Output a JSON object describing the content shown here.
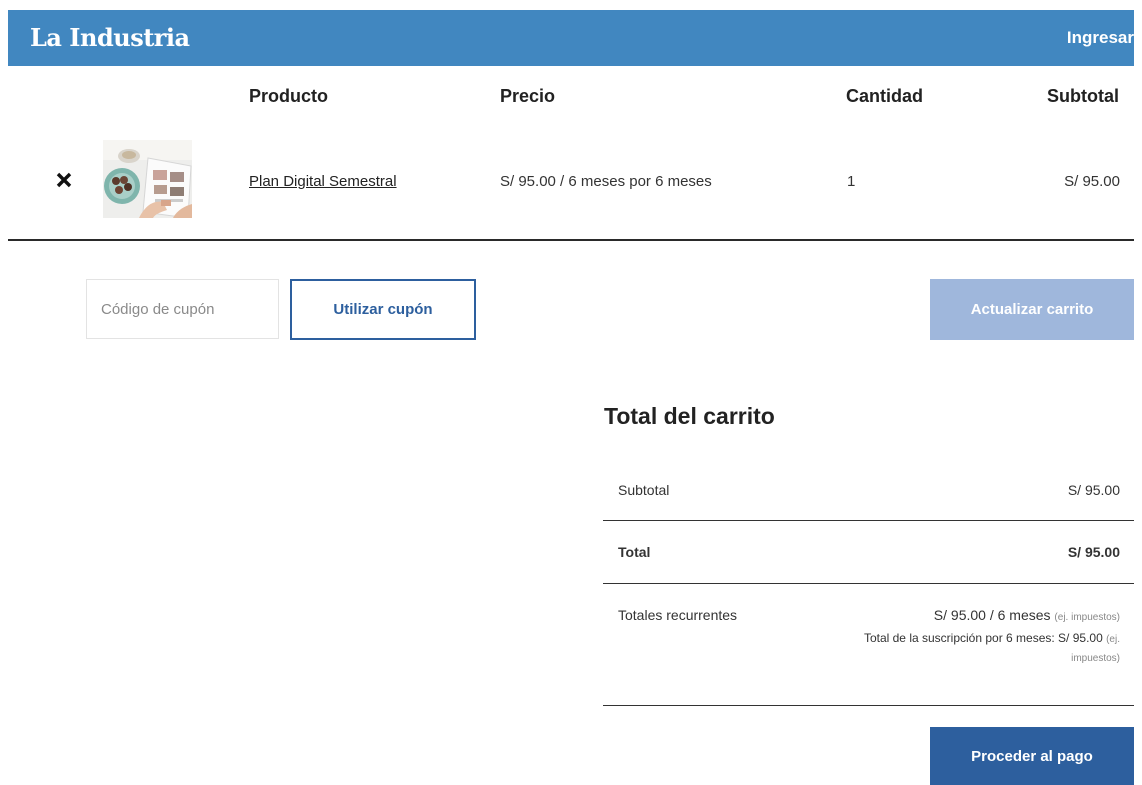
{
  "header": {
    "logo": "La Industria",
    "login_label": "Ingresar",
    "bg_color": "#4187c0"
  },
  "cart_table": {
    "columns": [
      "Producto",
      "Precio",
      "Cantidad",
      "Subtotal"
    ],
    "rows": [
      {
        "remove_icon": "close-icon",
        "product": "Plan Digital Semestral",
        "price": "S/ 95.00 / 6 meses por 6 meses",
        "quantity": "1",
        "subtotal": "S/ 95.00"
      }
    ]
  },
  "coupon": {
    "placeholder": "Código de cupón",
    "apply_label": "Utilizar cupón"
  },
  "update_cart_label": "Actualizar carrito",
  "totals": {
    "title": "Total del carrito",
    "subtotal_label": "Subtotal",
    "subtotal_value": "S/ 95.00",
    "total_label": "Total",
    "total_value": "S/ 95.00",
    "recurring_label": "Totales recurrentes",
    "recurring_amount": "S/ 95.00 / 6 meses",
    "recurring_tax_note": "(ej. impuestos)",
    "subscription_total": "Total de la suscripción por 6 meses: S/ 95.00",
    "subscription_tax_a": "(ej.",
    "subscription_tax_b": "impuestos)"
  },
  "checkout_label": "Proceder al pago",
  "colors": {
    "primary": "#2d5f9e",
    "disabled_button": "#9fb7dc"
  }
}
